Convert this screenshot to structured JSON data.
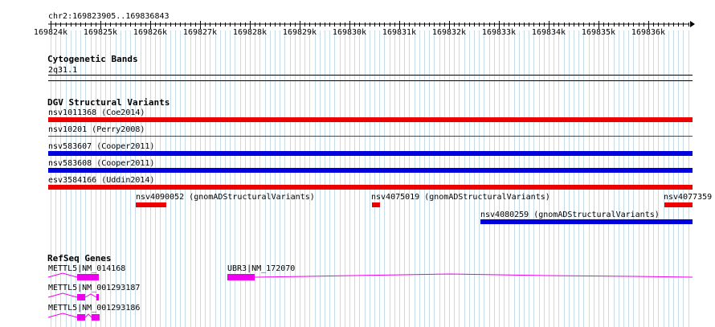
{
  "ruler": {
    "location": "chr2:169823905..169836843",
    "ticks": [
      "169824k",
      "169825k",
      "169826k",
      "169827k",
      "169828k",
      "169829k",
      "169830k",
      "169831k",
      "169832k",
      "169833k",
      "169834k",
      "169835k",
      "169836k"
    ]
  },
  "tracks": {
    "cytobands": {
      "title": "Cytogenetic Bands",
      "band": "2q31.1"
    },
    "dgv": {
      "title": "DGV Structural Variants",
      "features": [
        {
          "label": "nsv1011368 (Coe2014)",
          "color": "#ee0000"
        },
        {
          "label": "nsv10201 (Perry2008)",
          "color": "#ee0000"
        },
        {
          "label": "nsv583607 (Cooper2011)",
          "color": "#0000dd"
        },
        {
          "label": "nsv583608 (Cooper2011)",
          "color": "#0000dd"
        },
        {
          "label": "esv3584166 (Uddin2014)",
          "color": "#ee0000"
        },
        {
          "label": "nsv4090052 (gnomADStructuralVariants)",
          "color": "#ee0000"
        },
        {
          "label": "nsv4075019 (gnomADStructuralVariants)",
          "color": "#ee0000"
        },
        {
          "label": "nsv4077359",
          "color": "#ee0000"
        },
        {
          "label": "nsv4080259 (gnomADStructuralVariants)",
          "color": "#0000dd"
        }
      ]
    },
    "refseq": {
      "title": "RefSeq Genes",
      "color": "#ee00ee",
      "genes": [
        {
          "label": "METTL5|NM_014168"
        },
        {
          "label": "UBR3|NM_172070"
        },
        {
          "label": "METTL5|NM_001293187"
        },
        {
          "label": "METTL5|NM_001293186"
        }
      ]
    }
  }
}
